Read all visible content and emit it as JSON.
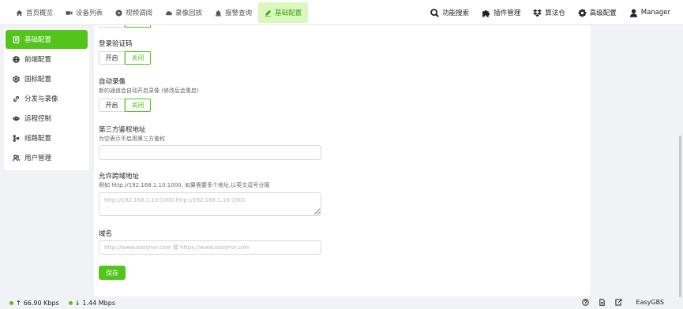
{
  "nav": {
    "left": [
      {
        "label": "首页概览",
        "icon": "home-icon"
      },
      {
        "label": "设备列表",
        "icon": "camera-icon"
      },
      {
        "label": "视频调阅",
        "icon": "play-icon"
      },
      {
        "label": "录像回放",
        "icon": "cloud-icon"
      },
      {
        "label": "报警查询",
        "icon": "alarm-icon"
      },
      {
        "label": "基础配置",
        "icon": "edit-icon",
        "active": true
      }
    ],
    "right": [
      {
        "label": "功能搜索",
        "icon": "search-icon"
      },
      {
        "label": "插件管理",
        "icon": "plugin-icon"
      },
      {
        "label": "算法仓",
        "icon": "dropbox-icon"
      },
      {
        "label": "高级配置",
        "icon": "gear-icon"
      },
      {
        "label": "Manager",
        "icon": "user-icon"
      }
    ]
  },
  "sidebar": {
    "items": [
      {
        "label": "基础配置",
        "icon": "document-icon",
        "active": true
      },
      {
        "label": "前端配置",
        "icon": "globe-icon"
      },
      {
        "label": "国标配置",
        "icon": "badge-icon"
      },
      {
        "label": "分发与录像",
        "icon": "link-icon"
      },
      {
        "label": "远程控制",
        "icon": "eye-icon"
      },
      {
        "label": "线路配置",
        "icon": "branch-icon"
      },
      {
        "label": "用户管理",
        "icon": "users-icon"
      }
    ]
  },
  "form": {
    "captcha": {
      "label": "登录验证码",
      "on_label": "开启",
      "off_label": "关闭",
      "selected": "关闭"
    },
    "auto_record": {
      "label": "自动录像",
      "desc": "新的通道会自动开启录像 (修改后会重启)",
      "on_label": "开启",
      "off_label": "关闭",
      "selected": "关闭"
    },
    "auth": {
      "label": "第三方鉴权地址",
      "desc": "为空表示不启用第三方鉴权",
      "value": ""
    },
    "cors": {
      "label": "允许跨域地址",
      "desc": "例如 http://192.168.1.10:1000, 如果需要多个地址,以英文逗号分隔",
      "placeholder": "http://192.168.1.10:1000,http://192.168.1.10:1001"
    },
    "domain": {
      "label": "域名",
      "placeholder": "http://www.easynvr.com 或 https://www.easynvr.com"
    },
    "save_label": "保存"
  },
  "status": {
    "upload": "66.90 Kbps",
    "download": "1.44 Mbps",
    "brand": "EasyGBS"
  },
  "colors": {
    "accent": "#52c41a",
    "accent_light": "#d9f7be"
  }
}
